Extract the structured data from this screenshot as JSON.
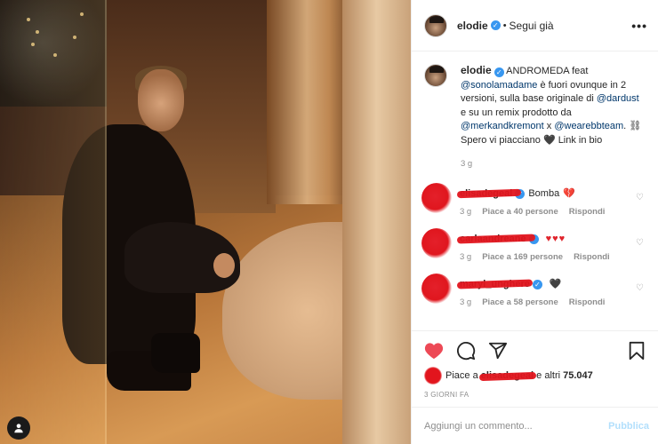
{
  "colors": {
    "brand_blue": "#3897f0",
    "like_red": "#ed4956",
    "muted": "#8e8e8e",
    "link": "#00376b",
    "redaction": "#e1151d"
  },
  "header": {
    "username": "elodie",
    "separator": "•",
    "follow_label": "Segui già",
    "more_label": "•••"
  },
  "caption": {
    "username": "elodie",
    "text_1": "ANDROMEDA feat",
    "mention_1": "@sonolamadame",
    "text_2": "è fuori ovunque in 2 versioni, sulla base originale di",
    "mention_2": "@dardust",
    "text_3": "e su un remix prodotto da",
    "mention_3": "@merkandkremont",
    "text_4": "x",
    "mention_4": "@wearebbteam",
    "text_5": ". ⛓ Spero vi piacciano 🖤 Link in bio",
    "time": "3 g"
  },
  "comments": [
    {
      "user": "elisadegeal",
      "text": "Bomba",
      "emoji": "💔",
      "time": "3 g",
      "likes": "Piace a 40 persone",
      "reply": "Rispondi"
    },
    {
      "user": "carlaandreane",
      "text": "",
      "emoji": "♥♥♥",
      "time": "3 g",
      "likes": "Piace a 169 persone",
      "reply": "Rispondi"
    },
    {
      "user": "maryl_unghere",
      "text": "",
      "emoji": "🖤",
      "time": "3 g",
      "likes": "Piace a 58 persone",
      "reply": "Rispondi"
    }
  ],
  "icons": {
    "like": "heart-icon",
    "comment": "comment-icon",
    "share": "share-icon",
    "save": "bookmark-icon",
    "comment_like": "small-heart-icon"
  },
  "likes": {
    "prefix": "Piace a",
    "user": "elisadegeal",
    "suffix": "e altri",
    "count": "75.047"
  },
  "date": "3 GIORNI FA",
  "add_comment": {
    "placeholder": "Aggiungi un commento...",
    "post_label": "Pubblica"
  }
}
